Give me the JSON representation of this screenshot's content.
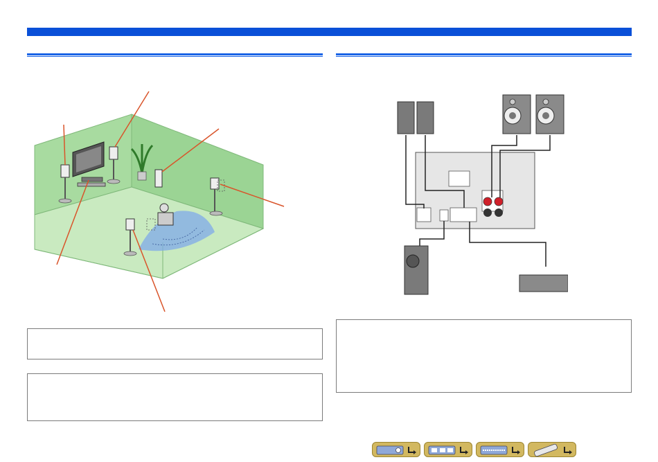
{
  "colors": {
    "header_band": "#0a50d8",
    "section_rule": "#1a64e6",
    "room_wall": "#a8dba0",
    "room_floor": "#c9eac0",
    "listening_area": "#7fa9ea",
    "leader_line": "#d9542a",
    "speaker_cable_red": "#d0202a",
    "nav_button": "#d2b860",
    "nav_button_border": "#9c8530",
    "box_border": "#7a7a7a"
  },
  "figures": {
    "room_layout": {
      "icon": "speaker-room-layout-illustration"
    },
    "connection": {
      "icon": "speaker-connection-diagram"
    }
  },
  "note_boxes": [
    {
      "name": "note-box-left-1"
    },
    {
      "name": "note-box-left-2"
    },
    {
      "name": "note-box-right-1"
    }
  ],
  "nav_buttons": [
    {
      "icon": "receiver-front-panel-icon",
      "arrow": "return-arrow-icon"
    },
    {
      "icon": "receiver-rear-panel-icon",
      "arrow": "return-arrow-icon"
    },
    {
      "icon": "front-display-icon",
      "arrow": "return-arrow-icon"
    },
    {
      "icon": "remote-control-icon",
      "arrow": "return-arrow-icon"
    }
  ]
}
